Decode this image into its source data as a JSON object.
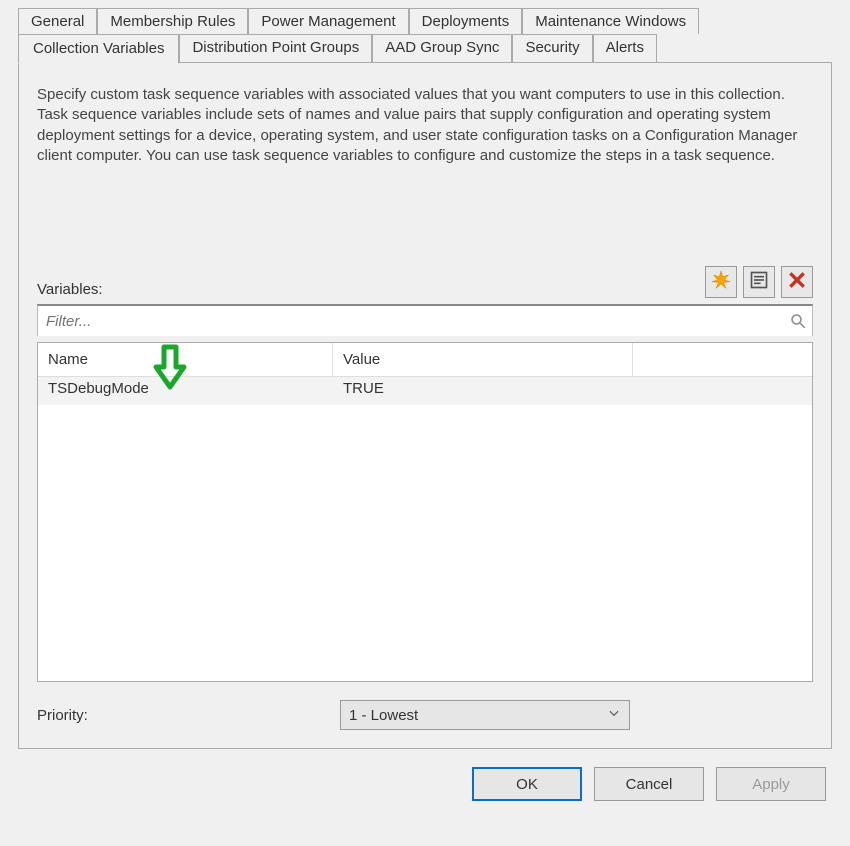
{
  "tabs_row1": [
    "General",
    "Membership Rules",
    "Power Management",
    "Deployments",
    "Maintenance Windows"
  ],
  "tabs_row2": [
    "Collection Variables",
    "Distribution Point Groups",
    "AAD Group Sync",
    "Security",
    "Alerts"
  ],
  "active_tab": "Collection Variables",
  "description": "Specify custom task sequence variables with associated values that you want computers to use in this collection. Task sequence variables include sets of names and value pairs that supply configuration and operating system deployment settings for a device, operating system, and user state configuration tasks on a Configuration Manager client computer. You can use task sequence variables to configure and customize the steps in a task sequence.",
  "variables_label": "Variables:",
  "filter_placeholder": "Filter...",
  "columns": {
    "name": "Name",
    "value": "Value"
  },
  "rows": [
    {
      "name": "TSDebugMode",
      "value": "TRUE"
    }
  ],
  "priority_label": "Priority:",
  "priority_value": "1 - Lowest",
  "buttons": {
    "ok": "OK",
    "cancel": "Cancel",
    "apply": "Apply"
  },
  "icons": {
    "new": "new-starburst-icon",
    "prop": "properties-icon",
    "del": "delete-x-icon"
  }
}
